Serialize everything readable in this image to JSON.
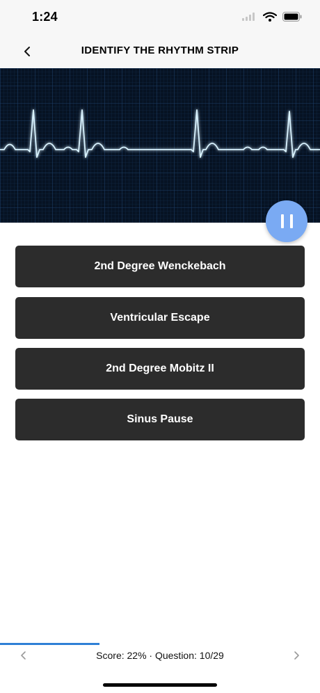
{
  "status_bar": {
    "time": "1:24"
  },
  "nav": {
    "title": "IDENTIFY THE RHYTHM STRIP",
    "back_icon": "chevron-left-icon"
  },
  "strip": {
    "background": "#061223",
    "grid_color": "#1c3e66",
    "trace_color": "#d9f3ff"
  },
  "controls": {
    "pause_icon": "pause-icon",
    "accent": "#7aaaf3"
  },
  "answers": [
    {
      "label": "2nd Degree Wenckebach"
    },
    {
      "label": "Ventricular Escape"
    },
    {
      "label": "2nd Degree Mobitz II"
    },
    {
      "label": "Sinus Pause"
    }
  ],
  "footer": {
    "score_text": "Score: 22% · Question: 10/29",
    "progress": 0.31,
    "progress_color": "#2f80d6"
  }
}
